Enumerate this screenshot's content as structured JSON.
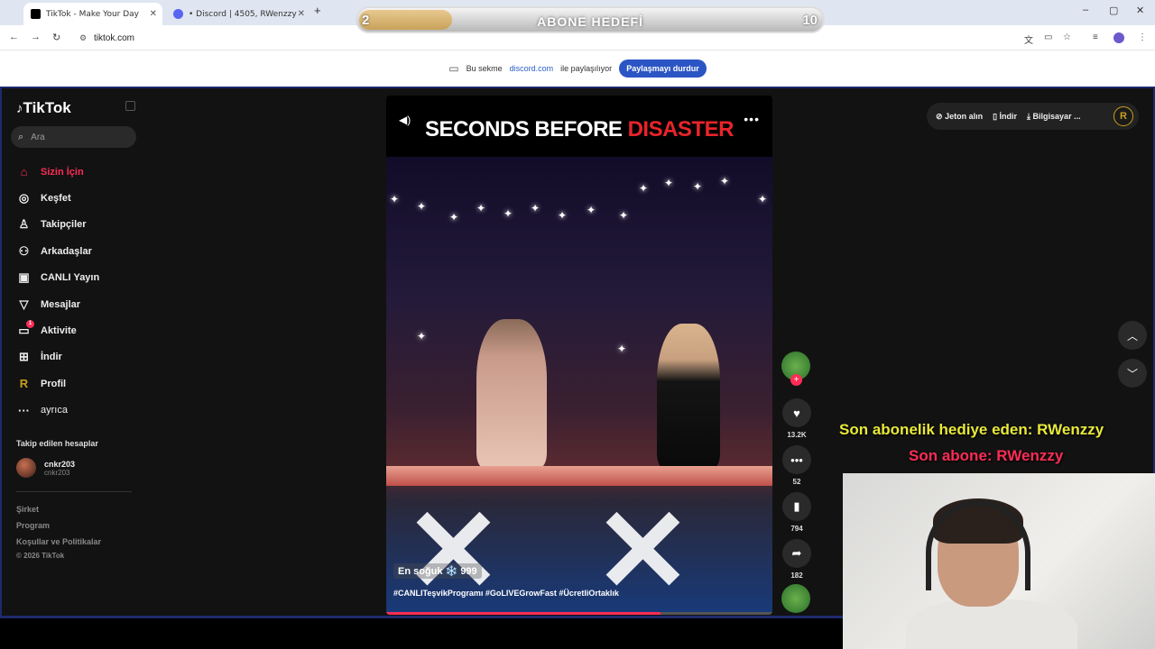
{
  "browser": {
    "tabs": [
      {
        "title": "TikTok - Make Your Day",
        "active": true
      },
      {
        "title": "• Discord | 4505, RWenzzy",
        "active": false
      }
    ],
    "url": "tiktok.com",
    "new_tab": "+",
    "window_controls": [
      "–",
      "▢",
      "✕"
    ]
  },
  "share_bar": {
    "prefix": "Bu sekme",
    "domain": "discord.com",
    "suffix": "ile paylaşılıyor",
    "stop_button": "Paylaşmayı durdur"
  },
  "stream_overlay": {
    "goal_label": "ABONE HEDEFİ",
    "goal_current": "2",
    "goal_target": "10",
    "goal_progress": 0.2,
    "last_gift_sub": "Son abonelik hediye eden: RWenzzy",
    "last_sub": "Son abone: RWenzzy"
  },
  "tiktok": {
    "logo": "TikTok",
    "search_placeholder": "Ara",
    "menu": [
      {
        "label": "Sizin İçin",
        "icon": "home-icon"
      },
      {
        "label": "Keşfet",
        "icon": "compass-icon"
      },
      {
        "label": "Takipçiler",
        "icon": "user-icon"
      },
      {
        "label": "Arkadaşlar",
        "icon": "users-icon"
      },
      {
        "label": "CANLI Yayın",
        "icon": "live-icon"
      },
      {
        "label": "Mesajlar",
        "icon": "send-icon"
      },
      {
        "label": "Aktivite",
        "icon": "inbox-icon",
        "badge": "1"
      },
      {
        "label": "İndir",
        "icon": "download-icon"
      },
      {
        "label": "Profil",
        "icon": "avatar-icon"
      },
      {
        "label": "ayrıca",
        "icon": "more-icon"
      }
    ],
    "followed_heading": "Takip edilen hesaplar",
    "followed": [
      {
        "name": "cnkr203",
        "handle": "cnkr203"
      }
    ],
    "footer": [
      "Şirket",
      "Program",
      "Koşullar ve Politikalar",
      "© 2026 TikTok"
    ],
    "topbar": {
      "coins": "Jeton alın",
      "download": "İndir",
      "desktop": "Bilgisayar ..."
    },
    "video": {
      "title_white": "SECONDS BEFORE",
      "title_red": "DISASTER",
      "caption": "En soğuk ❄️ 999",
      "hashtags": "#CANLITeşvikProgramı #GoLIVEGrowFast #ÜcretliOrtaklık",
      "progress": 0.71
    },
    "actions": {
      "likes": "13.2K",
      "comments": "52",
      "saves": "794",
      "shares": "182"
    }
  },
  "colors": {
    "accent": "#fe2c55",
    "share_button": "#2b55c4",
    "gift_text": "#e8e83a"
  }
}
